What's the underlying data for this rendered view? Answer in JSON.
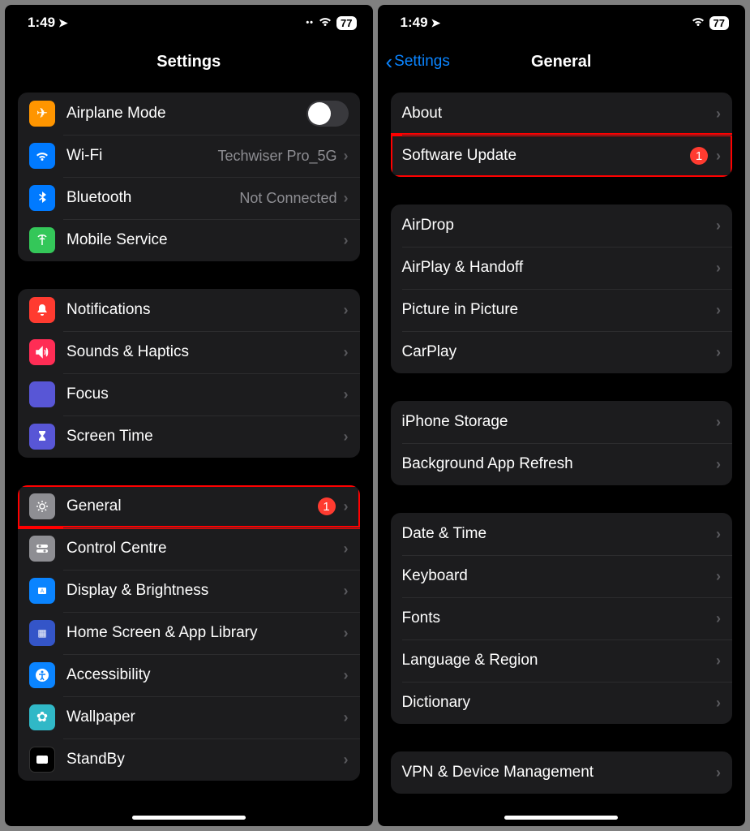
{
  "status": {
    "time": "1:49",
    "battery": "77"
  },
  "left": {
    "title": "Settings",
    "groups": [
      {
        "rows": [
          {
            "id": "airplane",
            "label": "Airplane Mode",
            "iconClass": "ic-airplane",
            "iconName": "airplane-icon",
            "iconChar": "✈",
            "type": "toggle",
            "toggled": false
          },
          {
            "id": "wifi",
            "label": "Wi-Fi",
            "iconClass": "ic-wifi",
            "iconName": "wifi-icon",
            "iconChar": "",
            "iconSvg": "wifi",
            "type": "link",
            "value": "Techwiser Pro_5G"
          },
          {
            "id": "bluetooth",
            "label": "Bluetooth",
            "iconClass": "ic-bluetooth",
            "iconName": "bluetooth-icon",
            "iconChar": "",
            "iconSvg": "bt",
            "type": "link",
            "value": "Not Connected"
          },
          {
            "id": "mobile",
            "label": "Mobile Service",
            "iconClass": "ic-mobile",
            "iconName": "antenna-icon",
            "iconChar": "",
            "iconSvg": "antenna",
            "type": "link"
          }
        ]
      },
      {
        "rows": [
          {
            "id": "notifications",
            "label": "Notifications",
            "iconClass": "ic-notifications",
            "iconName": "bell-icon",
            "iconChar": "",
            "iconSvg": "bell",
            "type": "link"
          },
          {
            "id": "sounds",
            "label": "Sounds & Haptics",
            "iconClass": "ic-sounds",
            "iconName": "speaker-icon",
            "iconChar": "",
            "iconSvg": "speaker",
            "type": "link"
          },
          {
            "id": "focus",
            "label": "Focus",
            "iconClass": "ic-focus",
            "iconName": "moon-icon",
            "iconChar": "",
            "iconSvg": "moon",
            "type": "link"
          },
          {
            "id": "screentime",
            "label": "Screen Time",
            "iconClass": "ic-screentime",
            "iconName": "hourglass-icon",
            "iconChar": "",
            "iconSvg": "hourglass",
            "type": "link"
          }
        ]
      },
      {
        "rows": [
          {
            "id": "general",
            "label": "General",
            "iconClass": "ic-general",
            "iconName": "gear-icon",
            "iconChar": "",
            "iconSvg": "gear",
            "type": "link",
            "badge": "1",
            "highlight": true
          },
          {
            "id": "control",
            "label": "Control Centre",
            "iconClass": "ic-control",
            "iconName": "switches-icon",
            "iconChar": "",
            "iconSvg": "switches",
            "type": "link"
          },
          {
            "id": "display",
            "label": "Display & Brightness",
            "iconClass": "ic-display",
            "iconName": "sun-icon",
            "iconChar": "",
            "iconSvg": "sun",
            "type": "link"
          },
          {
            "id": "home",
            "label": "Home Screen & App Library",
            "iconClass": "ic-home",
            "iconName": "grid-icon",
            "iconChar": "▦",
            "type": "link"
          },
          {
            "id": "accessibility",
            "label": "Accessibility",
            "iconClass": "ic-accessibility",
            "iconName": "accessibility-icon",
            "iconChar": "",
            "iconSvg": "access",
            "type": "link"
          },
          {
            "id": "wallpaper",
            "label": "Wallpaper",
            "iconClass": "ic-wallpaper",
            "iconName": "flower-icon",
            "iconChar": "✿",
            "type": "link"
          },
          {
            "id": "standby",
            "label": "StandBy",
            "iconClass": "ic-standby",
            "iconName": "clock-icon",
            "iconChar": "",
            "iconSvg": "standby",
            "type": "link"
          }
        ]
      }
    ]
  },
  "right": {
    "back": "Settings",
    "title": "General",
    "groups": [
      {
        "rows": [
          {
            "id": "about",
            "label": "About",
            "type": "link"
          },
          {
            "id": "software-update",
            "label": "Software Update",
            "type": "link",
            "badge": "1",
            "highlight": true
          }
        ]
      },
      {
        "rows": [
          {
            "id": "airdrop",
            "label": "AirDrop",
            "type": "link"
          },
          {
            "id": "airplay",
            "label": "AirPlay & Handoff",
            "type": "link"
          },
          {
            "id": "pip",
            "label": "Picture in Picture",
            "type": "link"
          },
          {
            "id": "carplay",
            "label": "CarPlay",
            "type": "link"
          }
        ]
      },
      {
        "rows": [
          {
            "id": "storage",
            "label": "iPhone Storage",
            "type": "link"
          },
          {
            "id": "refresh",
            "label": "Background App Refresh",
            "type": "link"
          }
        ]
      },
      {
        "rows": [
          {
            "id": "datetime",
            "label": "Date & Time",
            "type": "link"
          },
          {
            "id": "keyboard",
            "label": "Keyboard",
            "type": "link"
          },
          {
            "id": "fonts",
            "label": "Fonts",
            "type": "link"
          },
          {
            "id": "language",
            "label": "Language & Region",
            "type": "link"
          },
          {
            "id": "dictionary",
            "label": "Dictionary",
            "type": "link"
          }
        ]
      },
      {
        "rows": [
          {
            "id": "vpn",
            "label": "VPN & Device Management",
            "type": "link"
          }
        ]
      }
    ]
  }
}
